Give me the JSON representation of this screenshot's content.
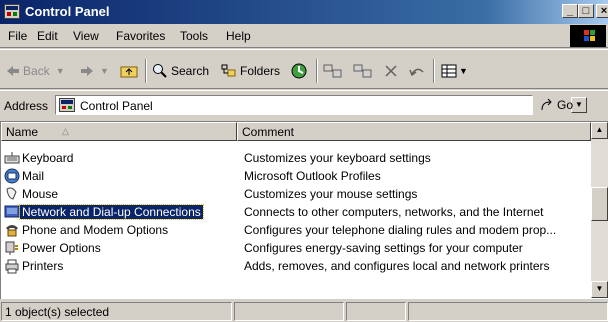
{
  "window": {
    "title": "Control Panel",
    "controls": {
      "minimize": "_",
      "maximize": "□",
      "close": "×"
    }
  },
  "menu": [
    "File",
    "Edit",
    "View",
    "Favorites",
    "Tools",
    "Help"
  ],
  "toolbar": {
    "back": "Back",
    "search": "Search",
    "folders": "Folders"
  },
  "address": {
    "label": "Address",
    "value": "Control Panel",
    "go": "Go"
  },
  "list": {
    "columns": [
      "Name",
      "Comment"
    ],
    "rows": [
      {
        "name": "Keyboard",
        "comment": "Customizes your keyboard settings",
        "icon": "keyboard-icon",
        "selected": false
      },
      {
        "name": "Mail",
        "comment": "Microsoft Outlook Profiles",
        "icon": "mail-icon",
        "selected": false
      },
      {
        "name": "Mouse",
        "comment": "Customizes your mouse settings",
        "icon": "mouse-icon",
        "selected": false
      },
      {
        "name": "Network and Dial-up Connections",
        "comment": "Connects to other computers, networks, and the Internet",
        "icon": "network-icon",
        "selected": true
      },
      {
        "name": "Phone and Modem Options",
        "comment": "Configures your telephone dialing rules and modem prop...",
        "icon": "phone-icon",
        "selected": false
      },
      {
        "name": "Power Options",
        "comment": "Configures energy-saving settings for your computer",
        "icon": "power-icon",
        "selected": false
      },
      {
        "name": "Printers",
        "comment": "Adds, removes, and configures local and network printers",
        "icon": "printer-icon",
        "selected": false
      }
    ]
  },
  "status": {
    "text": "1 object(s) selected"
  },
  "colors": {
    "title_start": "#0a246a",
    "title_end": "#a6caf0",
    "selection": "#0a246a",
    "face": "#d4d0c8"
  }
}
